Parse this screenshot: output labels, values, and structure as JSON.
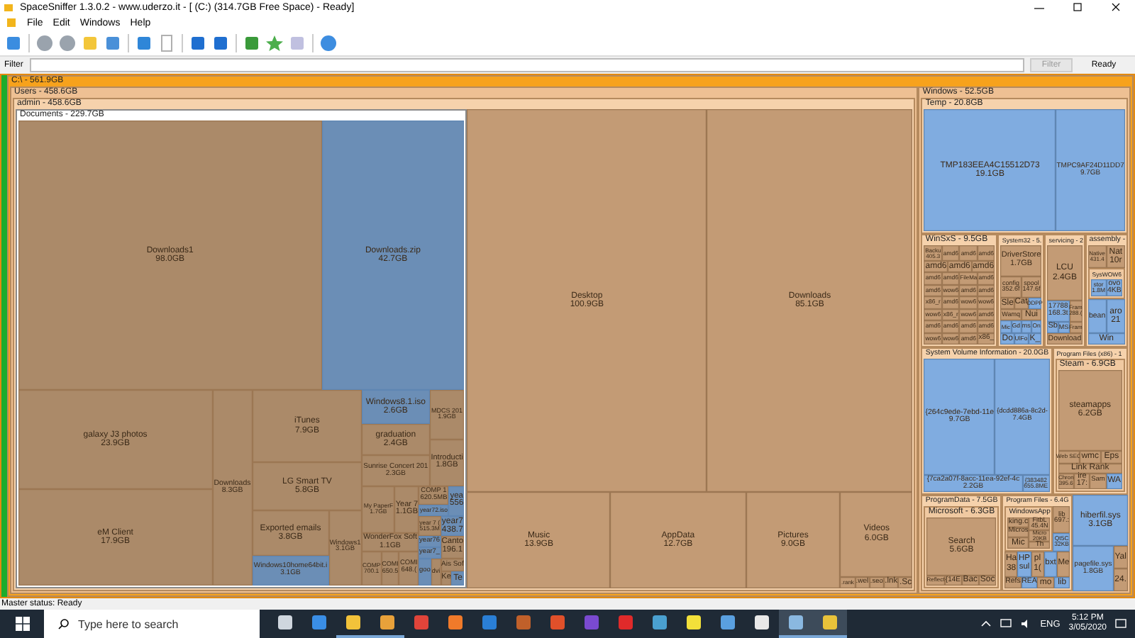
{
  "window": {
    "title": "SpaceSniffer 1.3.0.2 - www.uderzo.it - [ (C:) (314.7GB Free Space) - Ready]"
  },
  "menu": [
    "File",
    "Edit",
    "Windows",
    "Help"
  ],
  "filter_bar": {
    "label": "Filter",
    "button": {
      "label": "Filter",
      "disabled": true
    },
    "status": "Ready"
  },
  "treemap": {
    "kind": "folder",
    "label": "C:\\ - 561.9GB",
    "children": [
      {
        "kind": "folder",
        "label": "Users - 458.6GB",
        "children": [
          {
            "kind": "folder",
            "label": "admin - 458.6GB",
            "children": [
              {
                "kind": "folder",
                "label": "Documents - 229.7GB",
                "selected": true,
                "children": [
                  {
                    "kind": "folder",
                    "name": "Downloads1",
                    "size": "98.0GB"
                  },
                  {
                    "kind": "file",
                    "name": "Downloads.zip",
                    "size": "42.7GB"
                  },
                  {
                    "kind": "folder",
                    "name": "galaxy J3 photos",
                    "size": "23.9GB"
                  },
                  {
                    "kind": "folder",
                    "name": "eM Client",
                    "size": "17.9GB"
                  },
                  {
                    "kind": "folder",
                    "name": "Downloads",
                    "size": "8.3GB"
                  },
                  {
                    "kind": "folder",
                    "name": "iTunes",
                    "size": "7.9GB"
                  },
                  {
                    "kind": "folder",
                    "name": "LG Smart TV",
                    "size": "5.8GB"
                  },
                  {
                    "kind": "folder",
                    "name": "Exported emails",
                    "size": "3.8GB"
                  },
                  {
                    "kind": "file",
                    "name": "Windows10home64bit.i",
                    "size": "3.1GB"
                  },
                  {
                    "kind": "folder",
                    "name": "Windows1",
                    "size": "3.1GB"
                  },
                  {
                    "kind": "file",
                    "name": "Windows8.1.iso",
                    "size": "2.6GB"
                  },
                  {
                    "kind": "folder",
                    "name": "graduation",
                    "size": "2.4GB"
                  },
                  {
                    "kind": "folder",
                    "name": "Sunrise Concert 201",
                    "size": "2.3GB"
                  },
                  {
                    "kind": "folder",
                    "name": "MDCS 201",
                    "size": "1.9GB"
                  },
                  {
                    "kind": "folder",
                    "name": "Introducti",
                    "size": "1.8GB"
                  },
                  {
                    "kind": "folder",
                    "name": "My PaperF",
                    "size": "1.7GB"
                  },
                  {
                    "kind": "folder",
                    "name": "Year 7",
                    "size": "1.1GB"
                  },
                  {
                    "kind": "folder",
                    "name": "WonderFox Soft",
                    "size": "1.1GB"
                  },
                  {
                    "kind": "folder",
                    "name": "COMP",
                    "size": "700.1"
                  },
                  {
                    "kind": "folder",
                    "name": "COMI",
                    "size": "650.5"
                  },
                  {
                    "kind": "folder",
                    "name": "COMI",
                    "size": "648.("
                  },
                  {
                    "kind": "folder",
                    "name": "COMP 1",
                    "size": "620.5MB"
                  },
                  {
                    "kind": "file",
                    "name": "year72.iso"
                  },
                  {
                    "kind": "file",
                    "name": "yea",
                    "size": "556"
                  },
                  {
                    "kind": "folder",
                    "name": "year 7 (",
                    "size": "515.3M"
                  },
                  {
                    "kind": "file",
                    "name": "year7",
                    "size": "438.7"
                  },
                  {
                    "kind": "file",
                    "name": "year76"
                  },
                  {
                    "kind": "file",
                    "name": "year7_"
                  },
                  {
                    "kind": "folder",
                    "name": "Canto",
                    "size": "196.1"
                  },
                  {
                    "kind": "file",
                    "name": "goo"
                  },
                  {
                    "kind": "folder",
                    "name": "dvi"
                  },
                  {
                    "kind": "folder",
                    "name": "Ais Sof"
                  },
                  {
                    "kind": "folder",
                    "name": "Ke"
                  },
                  {
                    "kind": "file",
                    "name": "Te"
                  }
                ]
              },
              {
                "kind": "folder",
                "name": "Desktop",
                "size": "100.9GB",
                "selected": false
              },
              {
                "kind": "folder",
                "name": "Downloads",
                "size": "85.1GB",
                "selected": false
              },
              {
                "kind": "folder",
                "name": "Music",
                "size": "13.9GB",
                "selected": false
              },
              {
                "kind": "folder",
                "name": "AppData",
                "size": "12.7GB",
                "selected": false
              },
              {
                "kind": "folder",
                "name": "Pictures",
                "size": "9.0GB",
                "selected": false
              },
              {
                "kind": "folder",
                "name": "Videos",
                "size": "6.0GB",
                "selected": false
              },
              {
                "kind": "folder",
                "name": ".rank",
                "selected": false
              },
              {
                "kind": "folder",
                "name": ".wel",
                "selected": false
              },
              {
                "kind": "folder",
                "name": ".seo",
                "selected": false
              },
              {
                "kind": "folder",
                "name": ".lnk",
                "selected": false
              },
              {
                "kind": "folder",
                "name": ".Sc",
                "selected": false
              }
            ]
          }
        ]
      },
      {
        "kind": "folder",
        "label": "Windows - 52.5GB",
        "children": [
          {
            "kind": "folder",
            "label": "Temp - 20.8GB",
            "children": [
              {
                "kind": "file",
                "name": "TMP183EEA4C15512D73",
                "size": "19.1GB"
              },
              {
                "kind": "file",
                "name": "TMPC9AF24D11DD7",
                "size": "9.7GB"
              }
            ]
          },
          {
            "kind": "folder",
            "label": "WinSxS - 9.5GB",
            "children": [
              {
                "kind": "folder",
                "name": "Backu",
                "size": "405.3"
              },
              {
                "kind": "folder",
                "name": "amd6"
              },
              {
                "kind": "folder",
                "name": "amd6"
              },
              {
                "kind": "folder",
                "name": "amd6"
              },
              {
                "kind": "folder",
                "name": "amd6"
              },
              {
                "kind": "folder",
                "name": "amd6"
              },
              {
                "kind": "folder",
                "name": "amd6"
              },
              {
                "kind": "folder",
                "name": "amd6"
              },
              {
                "kind": "folder",
                "name": "amd6"
              },
              {
                "kind": "folder",
                "name": "FileMa"
              },
              {
                "kind": "folder",
                "name": "amd6"
              },
              {
                "kind": "folder",
                "name": "amd6"
              },
              {
                "kind": "folder",
                "name": "wow6"
              },
              {
                "kind": "folder",
                "name": "amd6"
              },
              {
                "kind": "folder",
                "name": "amd6"
              },
              {
                "kind": "folder",
                "name": "x86_r"
              },
              {
                "kind": "folder",
                "name": "amd6"
              },
              {
                "kind": "folder",
                "name": "wow6"
              },
              {
                "kind": "folder",
                "name": "wow6"
              },
              {
                "kind": "folder",
                "name": "wow6"
              },
              {
                "kind": "folder",
                "name": "x86_r"
              },
              {
                "kind": "folder",
                "name": "wow6"
              },
              {
                "kind": "folder",
                "name": "amd6"
              },
              {
                "kind": "folder",
                "name": "amd6"
              },
              {
                "kind": "folder",
                "name": "amd6"
              },
              {
                "kind": "folder",
                "name": "amd6"
              },
              {
                "kind": "folder",
                "name": "amd6"
              },
              {
                "kind": "folder",
                "name": "wow6"
              },
              {
                "kind": "folder",
                "name": "wow6"
              },
              {
                "kind": "folder",
                "name": "amd6"
              },
              {
                "kind": "folder",
                "name": "x86_"
              }
            ]
          },
          {
            "kind": "folder",
            "label": "System32 - 5.",
            "children": [
              {
                "kind": "folder",
                "name": "DriverStore",
                "size": "1.7GB"
              },
              {
                "kind": "folder",
                "name": "config",
                "size": "352.6f"
              },
              {
                "kind": "folder",
                "name": "spool",
                "size": "147.6f"
              },
              {
                "kind": "folder",
                "name": "Sle"
              },
              {
                "kind": "folder",
                "name": "Cat"
              },
              {
                "kind": "file",
                "name": "DDPP"
              },
              {
                "kind": "folder",
                "name": "Wamq"
              },
              {
                "kind": "folder",
                "name": "Nui"
              },
              {
                "kind": "file",
                "name": "Mic"
              },
              {
                "kind": "file",
                "name": "Gd"
              },
              {
                "kind": "file",
                "name": "ms"
              },
              {
                "kind": "file",
                "name": "On"
              },
              {
                "kind": "file",
                "name": "Do"
              },
              {
                "kind": "file",
                "name": "UlFo"
              },
              {
                "kind": "file",
                "name": "K_"
              }
            ]
          },
          {
            "kind": "folder",
            "label": "servicing - 2",
            "children": [
              {
                "kind": "folder",
                "name": "LCU",
                "size": "2.4GB"
              },
              {
                "kind": "file",
                "name": "17788",
                "size": "168.3t"
              },
              {
                "kind": "file",
                "name": "Sb"
              },
              {
                "kind": "file",
                "name": "MS"
              },
              {
                "kind": "folder",
                "name": "Fram",
                "size": "288.("
              },
              {
                "kind": "folder",
                "name": "Fram"
              },
              {
                "kind": "folder",
                "name": "Download"
              }
            ]
          },
          {
            "kind": "folder",
            "label": "assembly -",
            "children": [
              {
                "kind": "folder",
                "name": "Native",
                "size": "431.4"
              },
              {
                "kind": "folder",
                "name": "Nat",
                "size": "10r"
              },
              {
                "kind": "folder",
                "label": "SysWOW6",
                "children": [
                  {
                    "kind": "file",
                    "name": "stor",
                    "size": "1.8M"
                  },
                  {
                    "kind": "file",
                    "name": "ovo",
                    "size": "4KB"
                  }
                ]
              },
              {
                "kind": "file",
                "name": "bean"
              },
              {
                "kind": "file",
                "name": "aro",
                "size": "21"
              },
              {
                "kind": "file",
                "name": "Win"
              }
            ]
          },
          {
            "kind": "folder",
            "label": "System Volume Information - 20.0GB",
            "children": [
              {
                "kind": "file",
                "name": "{264c9ede-7ebd-11e",
                "size": "9.7GB"
              },
              {
                "kind": "file",
                "name": "{dcdd886a-8c2d-",
                "size": "7.4GB"
              },
              {
                "kind": "file",
                "name": "{7ca2a07f-8acc-11ea-92ef-4c",
                "size": "2.2GB"
              },
              {
                "kind": "file",
                "name": "{383482",
                "size": "655.8ME"
              }
            ]
          },
          {
            "kind": "folder",
            "label": "Program Files (x86) - 1",
            "children": [
              {
                "kind": "folder",
                "label": "Steam - 6.9GB",
                "children": [
                  {
                    "kind": "folder",
                    "name": "steamapps",
                    "size": "6.2GB"
                  },
                  {
                    "kind": "folder",
                    "name": "Web SEO"
                  },
                  {
                    "kind": "folder",
                    "name": "wmc"
                  },
                  {
                    "kind": "folder",
                    "name": "Eps"
                  },
                  {
                    "kind": "folder",
                    "name": "Link Rank"
                  },
                  {
                    "kind": "folder",
                    "name": "Chron",
                    "size": "395.6"
                  },
                  {
                    "kind": "folder",
                    "name": "ire",
                    "size": "17:"
                  },
                  {
                    "kind": "folder",
                    "name": "Sam"
                  },
                  {
                    "kind": "file",
                    "name": "WA"
                  }
                ]
              }
            ]
          },
          {
            "kind": "folder",
            "label": "ProgramData - 7.5GB",
            "children": [
              {
                "kind": "folder",
                "label": "Microsoft - 6.3GB",
                "children": [
                  {
                    "kind": "folder",
                    "name": "Search",
                    "size": "5.6GB"
                  },
                  {
                    "kind": "folder",
                    "name": "Reflect"
                  },
                  {
                    "kind": "folder",
                    "name": "{14E"
                  },
                  {
                    "kind": "folder",
                    "name": "Bac"
                  },
                  {
                    "kind": "folder",
                    "name": "Soc"
                  }
                ]
              }
            ]
          },
          {
            "kind": "folder",
            "label": "Program Files - 6.4G",
            "children": [
              {
                "kind": "folder",
                "label": "WindowsApp",
                "children": [
                  {
                    "kind": "folder",
                    "name": "king.c"
                  },
                  {
                    "kind": "folder",
                    "name": "Micros"
                  },
                  {
                    "kind": "folder",
                    "name": "Mic"
                  },
                  {
                    "kind": "folder",
                    "name": "FitbL",
                    "size": "45.4N"
                  },
                  {
                    "kind": "folder",
                    "name": "Micro",
                    "size": "20KB"
                  },
                  {
                    "kind": "folder",
                    "name": "Th"
                  }
                ]
              },
              {
                "kind": "folder",
                "name": "lib",
                "size": "697.:"
              },
              {
                "kind": "file",
                "name": "Qt5C",
                "size": "32KB"
              },
              {
                "kind": "folder",
                "name": "Ha",
                "size": "38"
              },
              {
                "kind": "file",
                "name": "HP",
                "size": "sul"
              },
              {
                "kind": "folder",
                "name": "pl",
                "size": "1("
              },
              {
                "kind": "file",
                "name": "bxt"
              },
              {
                "kind": "folder",
                "name": "Me"
              },
              {
                "kind": "folder",
                "name": "Refs"
              },
              {
                "kind": "file",
                "name": "REA"
              },
              {
                "kind": "folder",
                "name": "mo"
              },
              {
                "kind": "file",
                "name": "lib"
              }
            ]
          },
          {
            "kind": "file",
            "name": "hiberfil.sys",
            "size": "3.1GB"
          },
          {
            "kind": "file",
            "name": "pagefile.sys",
            "size": "1.8GB"
          },
          {
            "kind": "folder",
            "name": "Yal"
          },
          {
            "kind": "folder",
            "name": "24."
          }
        ]
      }
    ]
  },
  "status_bar": {
    "text": "Master status: Ready"
  },
  "taskbar": {
    "search": {
      "placeholder": "Type here to search"
    },
    "apps": [
      {
        "running": false,
        "active": false
      },
      {
        "running": false,
        "active": false
      },
      {
        "running": true,
        "active": false
      },
      {
        "running": true,
        "active": false
      },
      {
        "running": false,
        "active": false
      },
      {
        "running": false,
        "active": false
      },
      {
        "running": false,
        "active": false
      },
      {
        "running": false,
        "active": false
      },
      {
        "running": false,
        "active": false
      },
      {
        "running": false,
        "active": false
      },
      {
        "running": false,
        "active": false
      },
      {
        "running": false,
        "active": false
      },
      {
        "running": false,
        "active": false
      },
      {
        "running": false,
        "active": false
      },
      {
        "running": false,
        "active": false
      },
      {
        "running": true,
        "active": true
      },
      {
        "running": true,
        "active": true
      }
    ],
    "language": "ENG",
    "time": "5:12 PM",
    "date": "3/05/2020"
  }
}
